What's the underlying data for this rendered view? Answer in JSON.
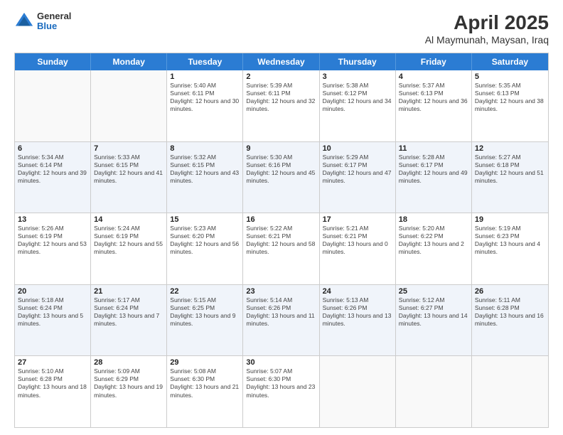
{
  "header": {
    "logo": {
      "line1": "General",
      "line2": "Blue"
    },
    "title": "April 2025",
    "location": "Al Maymunah, Maysan, Iraq"
  },
  "weekdays": [
    "Sunday",
    "Monday",
    "Tuesday",
    "Wednesday",
    "Thursday",
    "Friday",
    "Saturday"
  ],
  "rows": [
    [
      {
        "day": "",
        "info": ""
      },
      {
        "day": "",
        "info": ""
      },
      {
        "day": "1",
        "info": "Sunrise: 5:40 AM\nSunset: 6:11 PM\nDaylight: 12 hours and 30 minutes."
      },
      {
        "day": "2",
        "info": "Sunrise: 5:39 AM\nSunset: 6:11 PM\nDaylight: 12 hours and 32 minutes."
      },
      {
        "day": "3",
        "info": "Sunrise: 5:38 AM\nSunset: 6:12 PM\nDaylight: 12 hours and 34 minutes."
      },
      {
        "day": "4",
        "info": "Sunrise: 5:37 AM\nSunset: 6:13 PM\nDaylight: 12 hours and 36 minutes."
      },
      {
        "day": "5",
        "info": "Sunrise: 5:35 AM\nSunset: 6:13 PM\nDaylight: 12 hours and 38 minutes."
      }
    ],
    [
      {
        "day": "6",
        "info": "Sunrise: 5:34 AM\nSunset: 6:14 PM\nDaylight: 12 hours and 39 minutes."
      },
      {
        "day": "7",
        "info": "Sunrise: 5:33 AM\nSunset: 6:15 PM\nDaylight: 12 hours and 41 minutes."
      },
      {
        "day": "8",
        "info": "Sunrise: 5:32 AM\nSunset: 6:15 PM\nDaylight: 12 hours and 43 minutes."
      },
      {
        "day": "9",
        "info": "Sunrise: 5:30 AM\nSunset: 6:16 PM\nDaylight: 12 hours and 45 minutes."
      },
      {
        "day": "10",
        "info": "Sunrise: 5:29 AM\nSunset: 6:17 PM\nDaylight: 12 hours and 47 minutes."
      },
      {
        "day": "11",
        "info": "Sunrise: 5:28 AM\nSunset: 6:17 PM\nDaylight: 12 hours and 49 minutes."
      },
      {
        "day": "12",
        "info": "Sunrise: 5:27 AM\nSunset: 6:18 PM\nDaylight: 12 hours and 51 minutes."
      }
    ],
    [
      {
        "day": "13",
        "info": "Sunrise: 5:26 AM\nSunset: 6:19 PM\nDaylight: 12 hours and 53 minutes."
      },
      {
        "day": "14",
        "info": "Sunrise: 5:24 AM\nSunset: 6:19 PM\nDaylight: 12 hours and 55 minutes."
      },
      {
        "day": "15",
        "info": "Sunrise: 5:23 AM\nSunset: 6:20 PM\nDaylight: 12 hours and 56 minutes."
      },
      {
        "day": "16",
        "info": "Sunrise: 5:22 AM\nSunset: 6:21 PM\nDaylight: 12 hours and 58 minutes."
      },
      {
        "day": "17",
        "info": "Sunrise: 5:21 AM\nSunset: 6:21 PM\nDaylight: 13 hours and 0 minutes."
      },
      {
        "day": "18",
        "info": "Sunrise: 5:20 AM\nSunset: 6:22 PM\nDaylight: 13 hours and 2 minutes."
      },
      {
        "day": "19",
        "info": "Sunrise: 5:19 AM\nSunset: 6:23 PM\nDaylight: 13 hours and 4 minutes."
      }
    ],
    [
      {
        "day": "20",
        "info": "Sunrise: 5:18 AM\nSunset: 6:24 PM\nDaylight: 13 hours and 5 minutes."
      },
      {
        "day": "21",
        "info": "Sunrise: 5:17 AM\nSunset: 6:24 PM\nDaylight: 13 hours and 7 minutes."
      },
      {
        "day": "22",
        "info": "Sunrise: 5:15 AM\nSunset: 6:25 PM\nDaylight: 13 hours and 9 minutes."
      },
      {
        "day": "23",
        "info": "Sunrise: 5:14 AM\nSunset: 6:26 PM\nDaylight: 13 hours and 11 minutes."
      },
      {
        "day": "24",
        "info": "Sunrise: 5:13 AM\nSunset: 6:26 PM\nDaylight: 13 hours and 13 minutes."
      },
      {
        "day": "25",
        "info": "Sunrise: 5:12 AM\nSunset: 6:27 PM\nDaylight: 13 hours and 14 minutes."
      },
      {
        "day": "26",
        "info": "Sunrise: 5:11 AM\nSunset: 6:28 PM\nDaylight: 13 hours and 16 minutes."
      }
    ],
    [
      {
        "day": "27",
        "info": "Sunrise: 5:10 AM\nSunset: 6:28 PM\nDaylight: 13 hours and 18 minutes."
      },
      {
        "day": "28",
        "info": "Sunrise: 5:09 AM\nSunset: 6:29 PM\nDaylight: 13 hours and 19 minutes."
      },
      {
        "day": "29",
        "info": "Sunrise: 5:08 AM\nSunset: 6:30 PM\nDaylight: 13 hours and 21 minutes."
      },
      {
        "day": "30",
        "info": "Sunrise: 5:07 AM\nSunset: 6:30 PM\nDaylight: 13 hours and 23 minutes."
      },
      {
        "day": "",
        "info": ""
      },
      {
        "day": "",
        "info": ""
      },
      {
        "day": "",
        "info": ""
      }
    ]
  ]
}
